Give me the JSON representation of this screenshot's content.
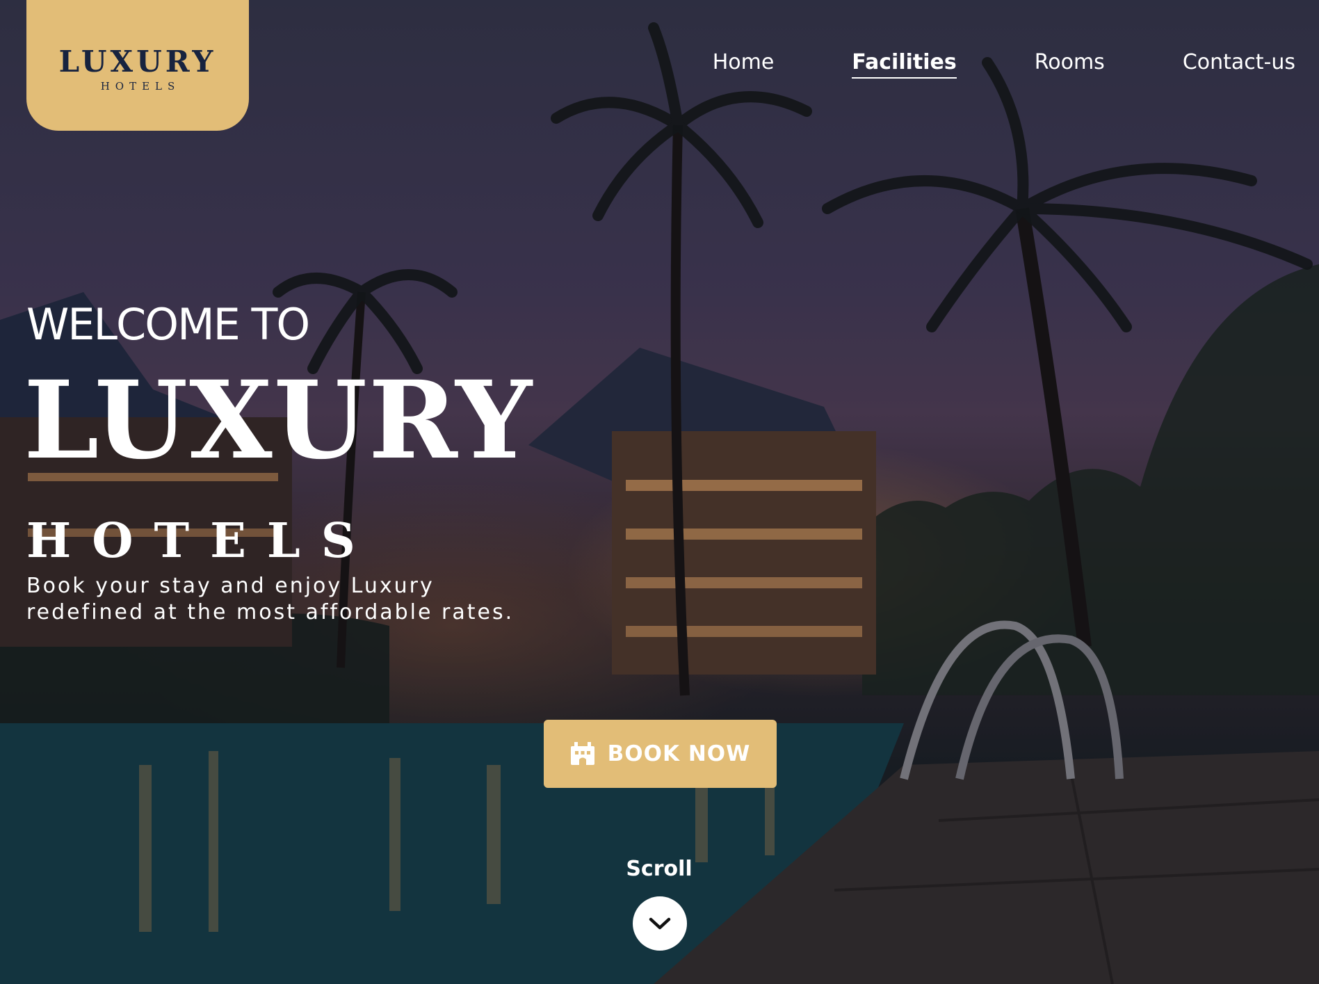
{
  "logo": {
    "main": "LUXURY",
    "sub": "HOTELS"
  },
  "nav": {
    "items": [
      {
        "label": "Home",
        "active": false
      },
      {
        "label": "Facilities",
        "active": true
      },
      {
        "label": "Rooms",
        "active": false
      },
      {
        "label": "Contact-us",
        "active": false
      }
    ]
  },
  "hero": {
    "welcome": "WELCOME TO",
    "title": "LUXURY",
    "subtitle": "HOTELS",
    "tagline_line1": "Book your stay and enjoy Luxury",
    "tagline_line2": "redefined at the most affordable rates."
  },
  "book_button": {
    "label": "BOOK NOW",
    "icon": "hotel-icon"
  },
  "scroll": {
    "label": "Scroll",
    "icon": "chevron-down-icon"
  },
  "colors": {
    "accent": "#e2bd77",
    "logo_text": "#17233f",
    "text": "#ffffff"
  }
}
